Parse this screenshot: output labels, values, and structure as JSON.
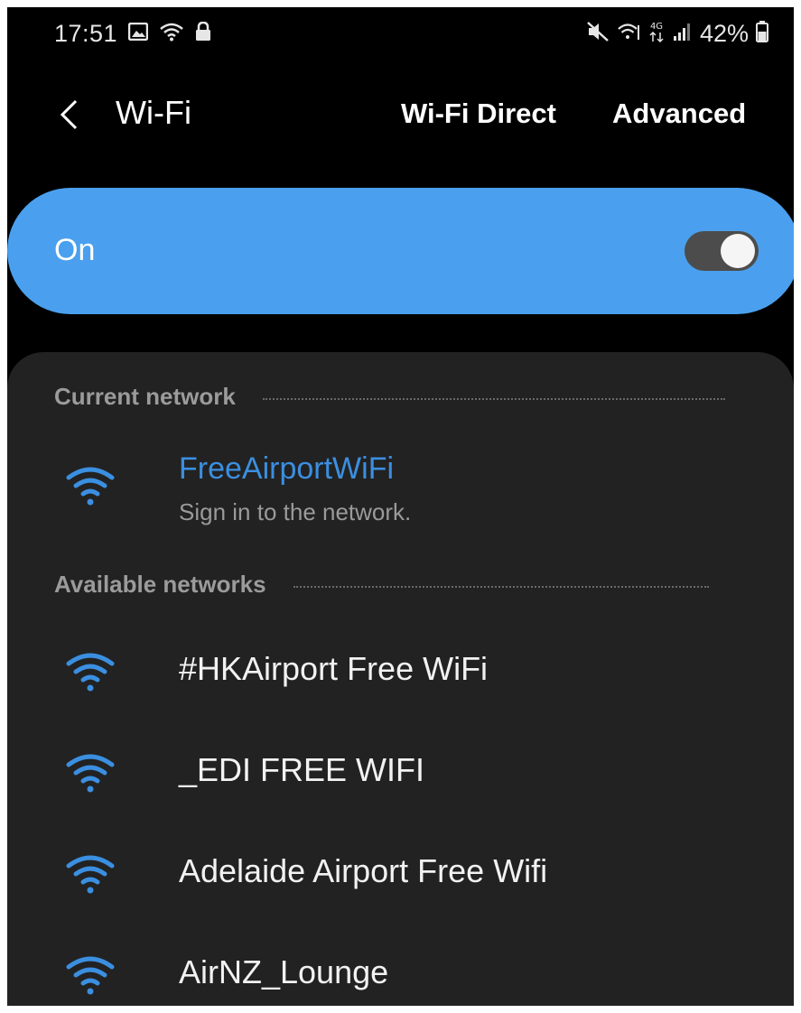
{
  "status_bar": {
    "time": "17:51",
    "battery_percent": "42%",
    "left_icons": [
      "gallery-icon",
      "wifi-status-icon",
      "lock-icon"
    ],
    "right_icons": [
      "mute-icon",
      "wifi-calling-icon",
      "4g-data-icon",
      "signal-icon",
      "battery-icon"
    ]
  },
  "header": {
    "title": "Wi-Fi",
    "wifi_direct_label": "Wi-Fi Direct",
    "advanced_label": "Advanced"
  },
  "toggle": {
    "label": "On",
    "state": true,
    "color": "#4aa0ee"
  },
  "current_network": {
    "section_label": "Current network",
    "name": "FreeAirportWiFi",
    "status": "Sign in to the network.",
    "name_color": "#3b8fe0"
  },
  "available_networks": {
    "section_label": "Available networks",
    "items": [
      {
        "name": "#HKAirport Free WiFi"
      },
      {
        "name": "_EDI FREE WIFI"
      },
      {
        "name": "Adelaide Airport Free Wifi"
      },
      {
        "name": "AirNZ_Lounge"
      }
    ]
  },
  "icon_color": "#3b8fe0"
}
